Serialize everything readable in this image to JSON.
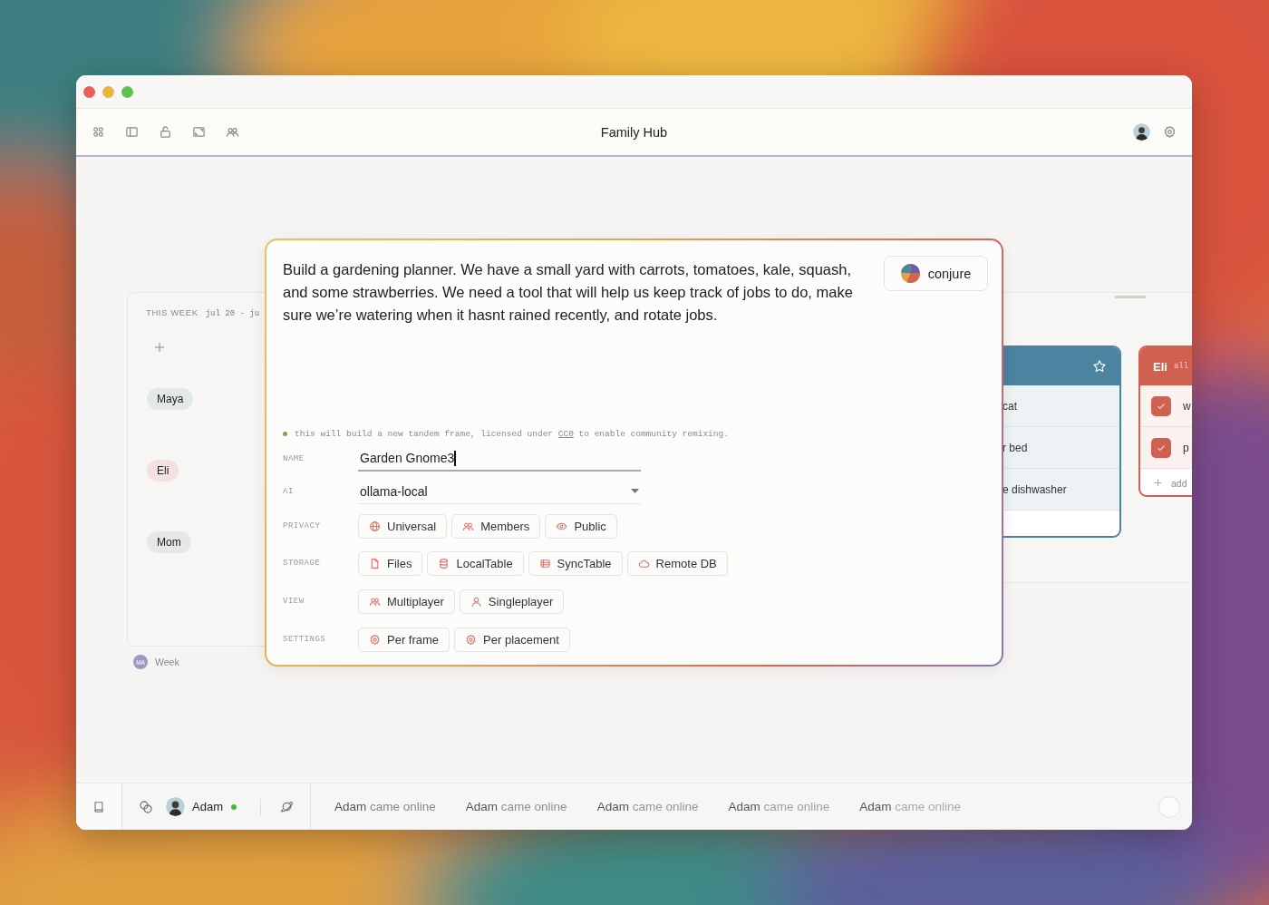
{
  "window": {
    "title": "Family Hub"
  },
  "week_card": {
    "label": "THIS WEEK",
    "range": "jul 20 - ju",
    "members": [
      {
        "name": "Maya",
        "color": "#e3e9e9"
      },
      {
        "name": "Eli",
        "color": "#f5e2df"
      },
      {
        "name": "Mom",
        "color": "#e7e7ea"
      }
    ],
    "footer": {
      "initials": "MA",
      "label": "Week"
    }
  },
  "list_cards": [
    {
      "kind": "plain",
      "color": "#4c83a1",
      "starred": false,
      "items": [
        {
          "text": "cat"
        },
        {
          "text": "r bed"
        },
        {
          "text": "e dishwasher"
        }
      ]
    },
    {
      "kind": "checklist",
      "color": "#d0604f",
      "title": "Eli",
      "subtitle": "all",
      "items": [
        {
          "text": "w",
          "checked": true
        },
        {
          "text": "p",
          "checked": true
        }
      ],
      "add_label": "add"
    }
  ],
  "conjure": {
    "prompt": "Build a gardening planner. We have a small yard with carrots, tomatoes, kale, squash, and some strawberries. We need a tool that will help us keep track of jobs to do, make sure we’re watering when it hasnt rained recently, and rotate jobs.",
    "button": "conjure",
    "note_before": "this will build a new tandem frame, licensed under",
    "license": "CC0",
    "note_after": "to enable community remixing.",
    "name_label": "NAME",
    "name_value": "Garden Gnome3",
    "ai_label": "AI",
    "ai_value": "ollama-local",
    "option_rows": [
      {
        "label": "PRIVACY",
        "options": [
          {
            "label": "Universal",
            "kind": "globe"
          },
          {
            "label": "Members",
            "kind": "people"
          },
          {
            "label": "Public",
            "kind": "eye"
          }
        ]
      },
      {
        "label": "STORAGE",
        "options": [
          {
            "label": "Files",
            "kind": "file"
          },
          {
            "label": "LocalTable",
            "kind": "database"
          },
          {
            "label": "SyncTable",
            "kind": "table"
          },
          {
            "label": "Remote DB",
            "kind": "cloud"
          }
        ]
      },
      {
        "label": "VIEW",
        "options": [
          {
            "label": "Multiplayer",
            "kind": "people"
          },
          {
            "label": "Singleplayer",
            "kind": "person"
          }
        ]
      },
      {
        "label": "SETTINGS",
        "options": [
          {
            "label": "Per frame",
            "kind": "gear"
          },
          {
            "label": "Per placement",
            "kind": "gear"
          }
        ]
      }
    ]
  },
  "status_bar": {
    "user": "Adam",
    "online": true,
    "activity": [
      "**Adam** came online",
      "**Adam** came online",
      "**Adam** came online",
      "**Adam** came online",
      "**Adam** came online"
    ]
  }
}
